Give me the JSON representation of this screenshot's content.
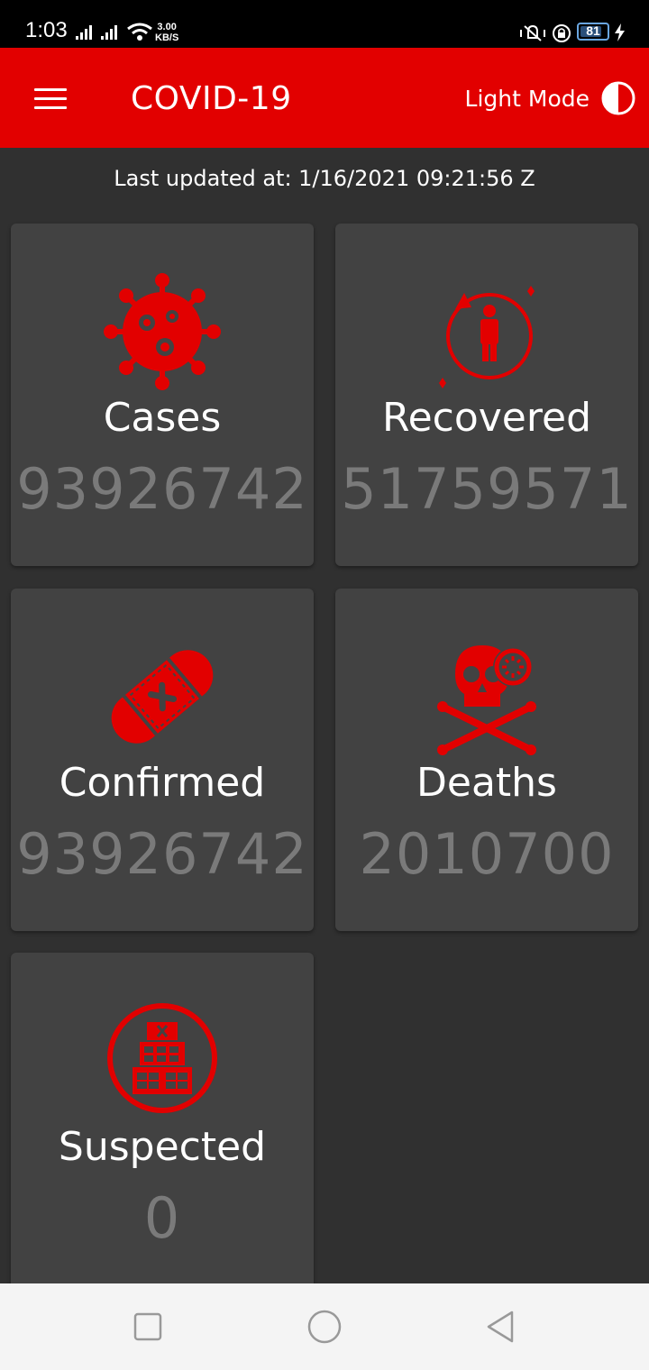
{
  "status_bar": {
    "time": "1:03",
    "speed_value": "3.00",
    "speed_unit": "KB/S",
    "battery": "81",
    "battery_level": 0.81
  },
  "app_bar": {
    "menu_icon": "hamburger-menu-icon",
    "title": "COVID-19",
    "mode_label": "Light Mode",
    "mode_icon": "half-circle-contrast-icon",
    "background": "#e20000"
  },
  "updated_text": "Last updated at: 1/16/2021 09:21:56 Z",
  "cards": {
    "cases": {
      "label": "Cases",
      "value": "93926742",
      "icon": "virus-icon"
    },
    "recovered": {
      "label": "Recovered",
      "value": "51759571",
      "icon": "recovered-person-icon"
    },
    "confirmed": {
      "label": "Confirmed",
      "value": "93926742",
      "icon": "bandage-icon"
    },
    "deaths": {
      "label": "Deaths",
      "value": "2010700",
      "icon": "skull-crossbones-icon"
    },
    "suspected": {
      "label": "Suspected",
      "value": "0",
      "icon": "hospital-building-icon"
    }
  },
  "accent_color": "#e20000",
  "nav_bar": {
    "recents_icon": "square-recents-icon",
    "home_icon": "circle-home-icon",
    "back_icon": "triangle-back-icon"
  }
}
